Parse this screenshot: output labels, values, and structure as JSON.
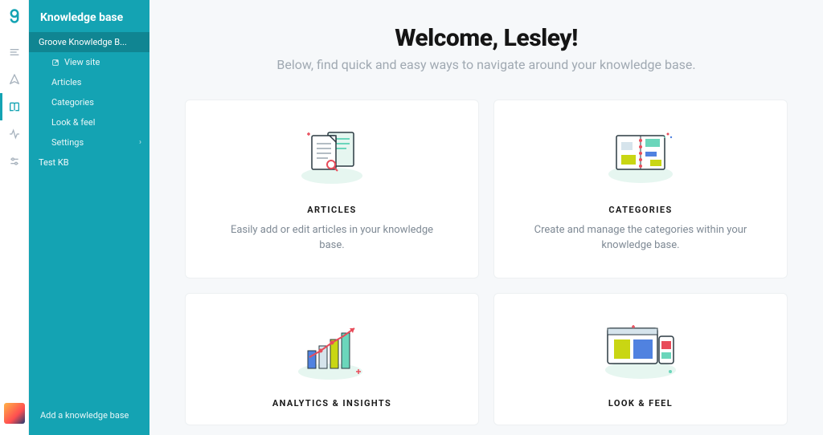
{
  "sidebar": {
    "title": "Knowledge base",
    "active_kb": "Groove Knowledge B...",
    "items": [
      "View site",
      "Articles",
      "Categories",
      "Look & feel",
      "Settings"
    ],
    "other_kb": "Test KB",
    "footer": "Add a knowledge base"
  },
  "welcome": {
    "heading": "Welcome, Lesley!",
    "sub": "Below, find quick and easy ways to navigate around your knowledge base."
  },
  "cards": [
    {
      "title": "ARTICLES",
      "desc": "Easily add or edit articles in your knowledge base."
    },
    {
      "title": "CATEGORIES",
      "desc": "Create and manage the categories within your knowledge base."
    },
    {
      "title": "ANALYTICS & INSIGHTS",
      "desc": ""
    },
    {
      "title": "LOOK & FEEL",
      "desc": ""
    }
  ]
}
